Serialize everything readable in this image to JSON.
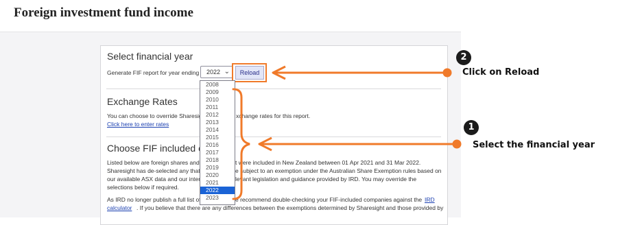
{
  "page": {
    "title": "Foreign investment fund income"
  },
  "select_year": {
    "heading": "Select financial year",
    "prompt": "Generate FIF report for year ending",
    "selected_value": "2022",
    "reload_label": "Reload"
  },
  "dropdown": {
    "options": [
      "2008",
      "2009",
      "2010",
      "2011",
      "2012",
      "2013",
      "2014",
      "2015",
      "2016",
      "2017",
      "2018",
      "2019",
      "2020",
      "2021",
      "2022",
      "2023"
    ],
    "selected": "2022"
  },
  "exchange_rates": {
    "heading": "Exchange Rates",
    "text_a": "You can choose to override Sharesig",
    "text_b": "xchange rates for this report.",
    "link": "Click here to enter rates"
  },
  "fif": {
    "heading": "Choose FIF included co",
    "line1_a": "Listed below are foreign shares and",
    "line1_b": "t were included in New Zealand between 01 Apr 2021 and 31 Mar 2022.",
    "line2_a": "Sharesight has de-selected any that",
    "line2_b": "e subject to an exemption under the Australian Share Exemption rules based on",
    "line3_a": "our available ASX data and our inter",
    "line3_b": "levant legislation and guidance provided by IRD. You may override the",
    "line4": "selections below if required.",
    "line5_a": "As IRD no longer publish a full list of",
    "line5_b": "e recommend double-checking your FIF-included companies against the",
    "line5_link": "IRD",
    "line6_link": "calculator",
    "line6_b": ". If you believe that there are any differences between the exemptions determined by Sharesight and those provided by"
  },
  "annotations": {
    "step1_number": "1",
    "step1_label": "Select the financial year",
    "step2_number": "2",
    "step2_label": "Click on Reload",
    "accent_color": "#f07a2a"
  }
}
